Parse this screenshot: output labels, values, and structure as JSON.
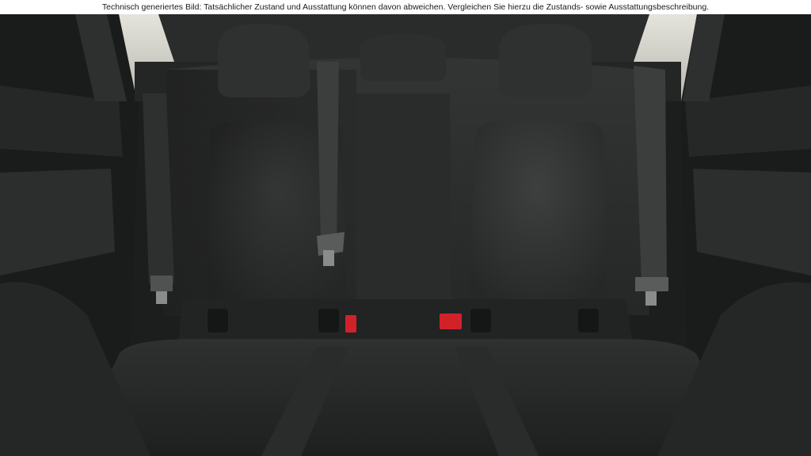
{
  "disclaimer": {
    "text": "Technisch generiertes Bild: Tatsächlicher Zustand und Ausstattung können davon abweichen. Vergleichen Sie hierzu die Zustands- sowie Ausstattungsbeschreibung."
  },
  "photo": {
    "subject": "car rear bench seat interior",
    "colors": {
      "upholstery": "#2b2c2c",
      "upholstery_light": "#3a3b3b",
      "shadow": "#111212",
      "headliner": "#d9d8d0",
      "belt": "#3c3d3d",
      "isofix_red": "#d1222a"
    }
  }
}
